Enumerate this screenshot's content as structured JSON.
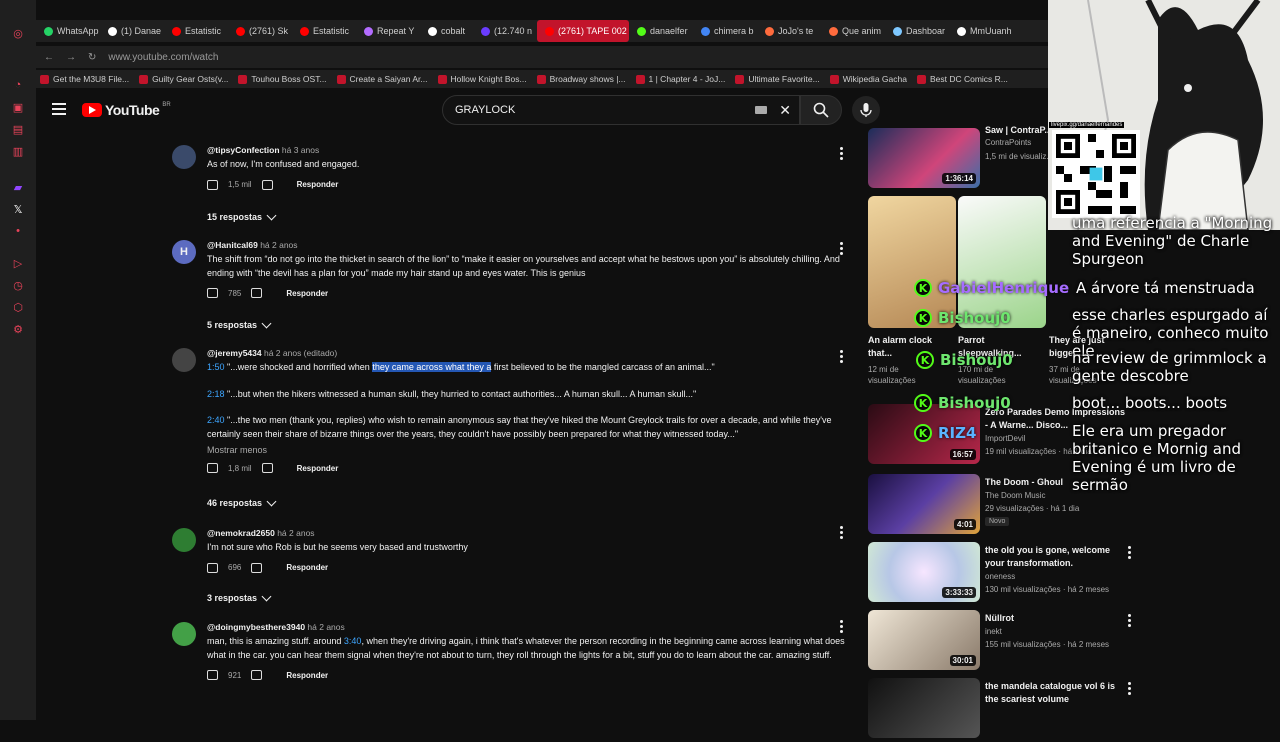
{
  "browser": {
    "tabs": [
      {
        "label": "WhatsApp",
        "color": "#25d366"
      },
      {
        "label": "(1) Danae",
        "color": "#ffffff"
      },
      {
        "label": "Estatistic",
        "color": "#ff0000"
      },
      {
        "label": "(2761) Sk",
        "color": "#ff0000"
      },
      {
        "label": "Estatistic",
        "color": "#ff0000"
      },
      {
        "label": "Repeat Y",
        "color": "#b36cff"
      },
      {
        "label": "cobalt",
        "color": "#ffffff"
      },
      {
        "label": "(12.740 n",
        "color": "#6a3cff"
      },
      {
        "label": "(2761) TAPE 002",
        "color": "#ff0000",
        "active": true
      },
      {
        "label": "danaelfer",
        "color": "#53fc18"
      },
      {
        "label": "chimera b",
        "color": "#4285f4"
      },
      {
        "label": "JoJo's te",
        "color": "#ff6b3d"
      },
      {
        "label": "Que anim",
        "color": "#ff6b3d"
      },
      {
        "label": "Dashboar",
        "color": "#7ec8ff"
      },
      {
        "label": "MmUuanh",
        "color": "#ffffff"
      }
    ],
    "url": "www.youtube.com/watch",
    "bookmarks": [
      {
        "label": "Get the M3U8 File..."
      },
      {
        "label": "Guilty Gear Osts(v..."
      },
      {
        "label": "Touhou Boss OST..."
      },
      {
        "label": "Create a Saiyan Ar..."
      },
      {
        "label": "Hollow Knight Bos..."
      },
      {
        "label": "Broadway shows |..."
      },
      {
        "label": "1 | Chapter 4 - JoJ..."
      },
      {
        "label": "Ultimate Favorite..."
      },
      {
        "label": "Wikipedia Gacha"
      },
      {
        "label": "Best DC Comics R..."
      }
    ]
  },
  "youtube": {
    "logo_text": "YouTube",
    "country": "BR",
    "search_value": "GRAYLOCK"
  },
  "comments": [
    {
      "author": "@tipsyConfection",
      "ago": "há 3 anos",
      "text": "As of now, I'm confused and engaged.",
      "likes": "1,5 mil",
      "reply": "Responder",
      "replies_label": "15 respostas",
      "avatar_color": "#3a4a6a",
      "avatar_letter": ""
    },
    {
      "author": "@Hanitcal69",
      "ago": "há 2 anos",
      "text": "The shift from “do not go into the thicket in search of the lion” to “make it easier on yourselves and accept what he bestows upon you” is absolutely chilling. And ending with “the devil has a plan for you” made my hair stand up and eyes water. This is genius",
      "likes": "785",
      "reply": "Responder",
      "replies_label": "5 respostas",
      "avatar_color": "#5c6bc0",
      "avatar_letter": "H"
    },
    {
      "author": "@jeremy5434",
      "ago": "há 2 anos (editado)",
      "lines": [
        {
          "ts": "1:50",
          "pre": " \"...were shocked and horrified when ",
          "hl": "they came across what they a",
          "post": " first believed to be the mangled carcass of an animal...\""
        },
        {
          "ts": "2:18",
          "pre": " \"...but when the hikers witnessed a human skull, they hurried to contact authorities... A human skull... A human skull...\"",
          "hl": "",
          "post": ""
        },
        {
          "ts": "2:40",
          "pre": " \"...the two men (thank you, replies) who wish to remain anonymous say that they've hiked the Mount Greylock trails for over a decade, and while they've certainly seen their share of bizarre things over the years, they couldn't have possibly been prepared for what they witnessed today...\"",
          "hl": "",
          "post": ""
        }
      ],
      "show_less": "Mostrar menos",
      "likes": "1,8 mil",
      "reply": "Responder",
      "replies_label": "46 respostas",
      "avatar_color": "#444",
      "avatar_letter": ""
    },
    {
      "author": "@nemokrad2650",
      "ago": "há 2 anos",
      "text": "I'm not sure who Rob is but he seems very based and trustworthy",
      "likes": "696",
      "reply": "Responder",
      "replies_label": "3 respostas",
      "avatar_color": "#2e7d32",
      "avatar_letter": ""
    },
    {
      "author": "@doingmybesthere3940",
      "ago": "há 2 anos",
      "text_pre": "man, this is amazing stuff. around ",
      "ts": "3:40",
      "text_post": ", when they're driving again, i think that's whatever the person recording in the beginning came across learning what does what in the car. you can hear them signal when they're not about to turn, they roll through the lights for a bit, stuff you do to learn about the car. amazing stuff.",
      "likes": "921",
      "reply": "Responder",
      "avatar_color": "#43a047",
      "avatar_letter": ""
    }
  ],
  "related": [
    {
      "title": "Saw | ContraP...",
      "channel": "ContraPoints",
      "stats": "1,5 mi de visualiz...",
      "duration": "1:36:14",
      "color": "#3a6fa8"
    },
    {
      "title": "Zero Parades Demo Impressions - A Warne... Disco...",
      "channel": "ImportDevil",
      "stats": "19 mil visualizações · há 1 dia",
      "duration": "16:57",
      "color": "#b7274a"
    },
    {
      "title": "The Doom - Ghoul",
      "channel": "The Doom Music",
      "stats": "29 visualizações · há 1 dia",
      "duration": "4:01",
      "badge": "Novo",
      "color": "#5b3fa3"
    },
    {
      "title": "the old you is gone, welcome your transformation.",
      "channel": "oneness",
      "stats": "130 mil visualizações · há 2 meses",
      "duration": "3:33:33",
      "color": "#b7c7e6"
    },
    {
      "title": "Nüllrot",
      "channel": "inekt",
      "stats": "155 mil visualizações · há 2 meses",
      "duration": "30:01",
      "color": "#d7cbb9"
    },
    {
      "title": "the mandela catalogue vol 6 is the scariest volume",
      "channel": "",
      "stats": "",
      "duration": "",
      "color": "#333"
    }
  ],
  "shorts": [
    {
      "title": "An alarm clock that...",
      "stats": "12 mi de visualizações",
      "color": "#d8b68c"
    },
    {
      "title": "Parrot sleepwalking...",
      "stats": "170 mi de visualizações",
      "color": "#f2f2f2"
    },
    {
      "title": "They are just bigger...",
      "stats": "37 mi de visualizações",
      "color": "#8a7a6a"
    }
  ],
  "stream": {
    "qr_label": "livepix.gg/danaelfernandes",
    "messages": [
      {
        "text": "uma referencia a \"Morning and Evening\" de Charle Spurgeon"
      },
      {
        "user": "GabielHenrique",
        "text": "A árvore tá menstruada"
      },
      {
        "text": "esse charles espurgado aí é maneiro, conheco muito ele"
      },
      {
        "user": "Bishouj0",
        "text": ""
      },
      {
        "text": "na review de grimmlock a gente descobre"
      },
      {
        "user": "Bishouj0",
        "text": ""
      },
      {
        "text": "boot... boots... boots"
      },
      {
        "user": "RIZ4",
        "text": ""
      },
      {
        "text": "Ele era um pregador britanico e Mornig and Evening é um livro de sermão"
      }
    ]
  }
}
